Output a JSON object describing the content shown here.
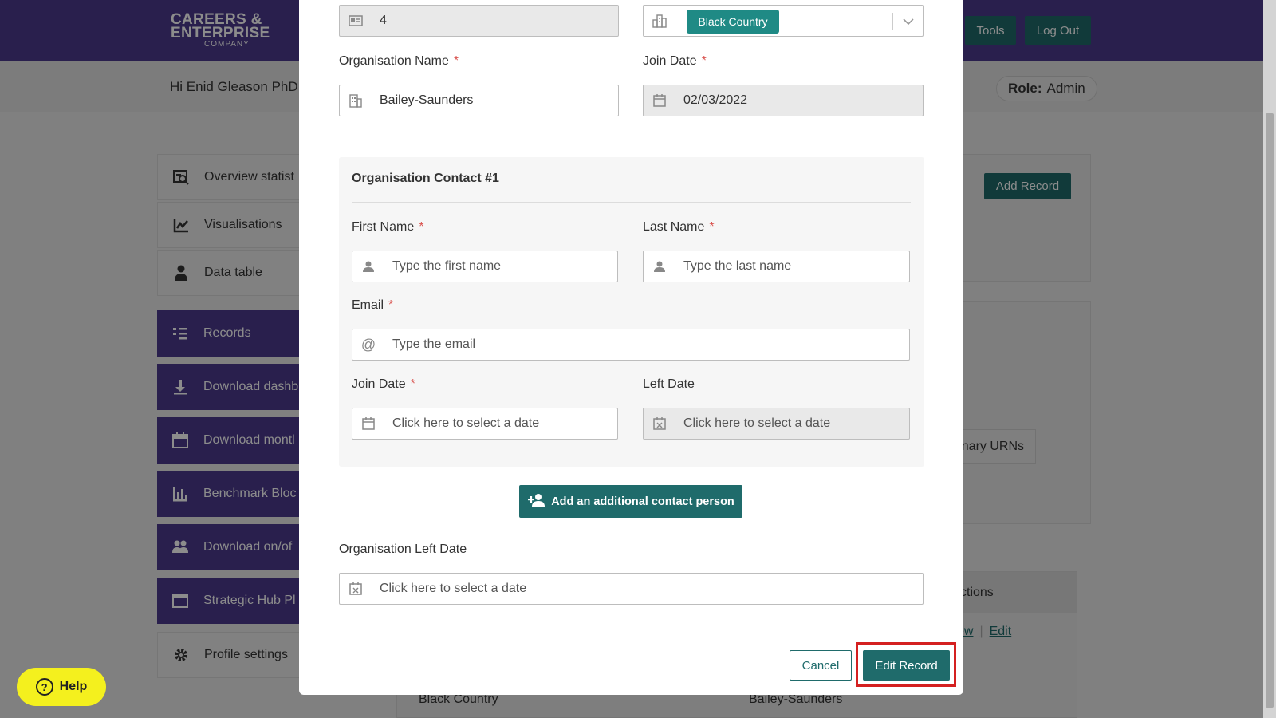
{
  "header": {
    "logo_line1": "CAREERS &",
    "logo_line2": "ENTERPRISE",
    "logo_line3": "COMPANY",
    "tools_label": "Tools",
    "logout_label": "Log Out"
  },
  "greeting": "Hi Enid Gleason PhD E",
  "role": {
    "label": "Role:",
    "value": "Admin"
  },
  "sidebar": {
    "items": [
      {
        "label": "Overview statist"
      },
      {
        "label": "Visualisations"
      },
      {
        "label": "Data table"
      },
      {
        "label": "Records"
      },
      {
        "label": "Download dashb"
      },
      {
        "label": "Download montl"
      },
      {
        "label": "Benchmark Bloc"
      },
      {
        "label": "Download on/of"
      },
      {
        "label": "Strategic Hub Pl"
      },
      {
        "label": "Profile settings"
      }
    ]
  },
  "background": {
    "add_record_label": "Add Record",
    "urns_label": "nary URNs",
    "actions_header": "ctions",
    "link_view": "ew",
    "link_edit": "Edit",
    "row_region": "Black Country",
    "row_org": "Bailey-Saunders"
  },
  "help_label": "Help",
  "modal": {
    "id_value": "4",
    "region_tag": "Black Country",
    "org_name_label": "Organisation Name",
    "org_name_value": "Bailey-Saunders",
    "join_date_label": "Join Date",
    "join_date_value": "02/03/2022",
    "contact_title": "Organisation Contact #1",
    "first_name_label": "First Name",
    "first_name_placeholder": "Type the first name",
    "last_name_label": "Last Name",
    "last_name_placeholder": "Type the last name",
    "email_label": "Email",
    "email_placeholder": "Type the email",
    "contact_join_label": "Join Date",
    "contact_join_placeholder": "Click here to select a date",
    "left_date_label": "Left Date",
    "left_date_placeholder": "Click here to select a date",
    "add_contact_label": "Add an additional contact person",
    "org_left_label": "Organisation Left Date",
    "org_left_placeholder": "Click here to select a date",
    "cancel_label": "Cancel",
    "edit_record_label": "Edit Record",
    "required_mark": "*"
  },
  "colors": {
    "brand_purple": "#4c3a8c",
    "teal": "#1f6b6b",
    "highlight_red": "#d42020"
  }
}
